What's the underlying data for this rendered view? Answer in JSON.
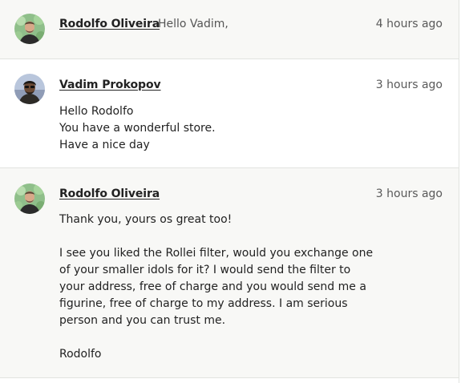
{
  "messages": [
    {
      "sender": "Rodolfo Oliveira",
      "preview": "Hello Vadim,",
      "time": "4 hours ago",
      "avatar": "rodolfo-avatar"
    },
    {
      "sender": "Vadim Prokopov",
      "time": "3 hours ago",
      "avatar": "vadim-avatar",
      "body": "Hello Rodolfo\nYou have a wonderful store.\nHave a nice day"
    },
    {
      "sender": "Rodolfo Oliveira",
      "time": "3 hours ago",
      "avatar": "rodolfo-avatar",
      "body": "Thank you, yours os great too!\n\nI see you liked the Rollei filter, would you exchange one of your smaller idols for it? I would send the filter to your address, free of charge and you would send me a figurine, free of charge to my address. I am serious person and you can trust me.\n\nRodolfo"
    }
  ],
  "colors": {
    "shaded_background": "#f8f8f6",
    "divider": "#e1e3df",
    "text": "#222222",
    "muted_text": "#595959"
  }
}
